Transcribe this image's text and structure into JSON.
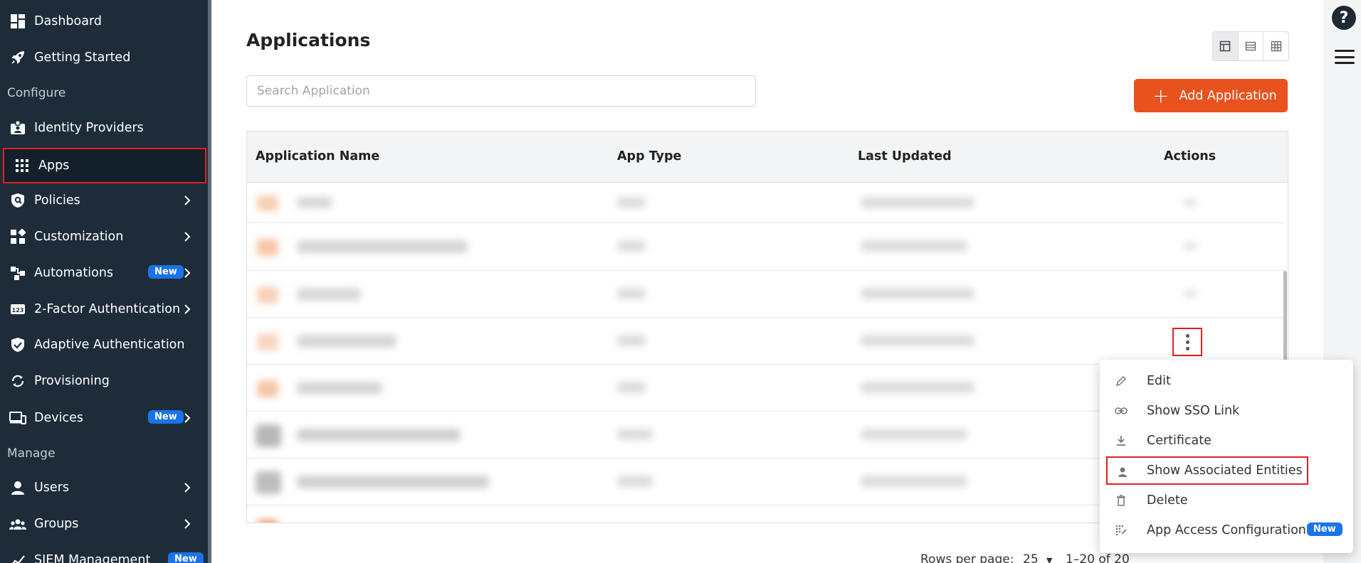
{
  "sidebar": {
    "items": [
      {
        "label": "Dashboard",
        "icon": "dashboard-icon"
      },
      {
        "label": "Getting Started",
        "icon": "rocket-icon"
      },
      {
        "label": "Identity Providers",
        "icon": "id-badge-icon"
      },
      {
        "label": "Apps",
        "icon": "apps-grid-icon"
      },
      {
        "label": "Policies",
        "icon": "shield-icon"
      },
      {
        "label": "Customization",
        "icon": "customization-icon"
      },
      {
        "label": "Automations",
        "icon": "automation-icon"
      },
      {
        "label": "2-Factor Authentication",
        "icon": "123-icon"
      },
      {
        "label": "Adaptive Authentication",
        "icon": "shield-check-icon"
      },
      {
        "label": "Provisioning",
        "icon": "sync-icon"
      },
      {
        "label": "Devices",
        "icon": "devices-icon"
      },
      {
        "label": "Users",
        "icon": "user-icon"
      },
      {
        "label": "Groups",
        "icon": "groups-icon"
      },
      {
        "label": "SIEM Management",
        "icon": "chart-line-icon"
      }
    ],
    "sections": {
      "configure": "Configure",
      "manage": "Manage"
    },
    "badge_new": "New"
  },
  "main": {
    "title": "Applications",
    "search_placeholder": "Search Application",
    "add_button": "Add Application",
    "table": {
      "headers": [
        "Application Name",
        "App Type",
        "Last Updated",
        "Actions"
      ]
    },
    "pager": {
      "rows_per_page_label": "Rows per page:",
      "rows_per_page_value": "25",
      "range": "1–20 of 20"
    }
  },
  "menu": {
    "items": [
      {
        "label": "Edit",
        "icon": "pencil-icon"
      },
      {
        "label": "Show SSO Link",
        "icon": "link-icon"
      },
      {
        "label": "Certificate",
        "icon": "download-icon"
      },
      {
        "label": "Show Associated Entities",
        "icon": "person-icon"
      },
      {
        "label": "Delete",
        "icon": "trash-icon"
      },
      {
        "label": "App Access Configuration",
        "icon": "access-config-icon"
      }
    ],
    "badge_new": "New"
  },
  "colors": {
    "sidebar_bg": "#1e2c3a",
    "accent": "#e8521f",
    "badge": "#1a73e8",
    "highlight_border": "#e02020"
  }
}
